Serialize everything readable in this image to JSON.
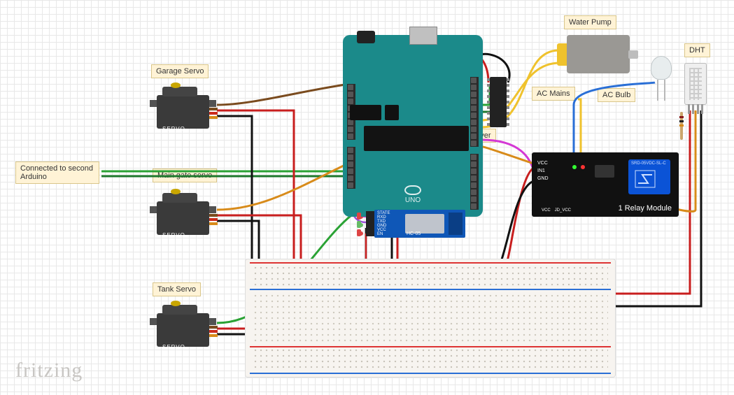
{
  "labels": {
    "garage_servo": "Garage Servo",
    "main_gate_servo": "Main gate servo",
    "tank_servo": "Tank Servo",
    "connected_second": "Connected to second\nArduino",
    "water_pump": "Water Pump",
    "dht": "DHT",
    "ac_mains": "AC Mains",
    "ac_bulb": "AC Bulb",
    "motor_driver": "Motor Driver"
  },
  "components": {
    "arduino": {
      "model": "UNO",
      "brand": "Arduino"
    },
    "relay": {
      "title": "1 Relay Module",
      "pins": [
        "VCC",
        "IN1",
        "GND"
      ],
      "bottom_pins": [
        "VCC",
        "JD_VCC"
      ],
      "part_no": "SRD-05VDC-SL-C"
    },
    "bluetooth": {
      "model": "HC-05",
      "pin_labels": [
        "STATE",
        "RXD",
        "TXD",
        "GND",
        "VCC",
        "EN"
      ]
    },
    "servos": [
      {
        "role": "garage",
        "text": "SERVO"
      },
      {
        "role": "main_gate",
        "text": "SERVO"
      },
      {
        "role": "tank",
        "text": "SERVO"
      }
    ],
    "dht_sensor": {
      "pins": 4
    },
    "led": {
      "type": "RGB clear"
    },
    "motor_driver_ic": {
      "pins": 16
    }
  },
  "wire_colors": {
    "5v": "#c81e1e",
    "gnd": "#111111",
    "brown": "#7a4b1e",
    "orange": "#d88b1a",
    "yellow": "#efc22d",
    "green": "#2aa234",
    "green2": "#1f7a2e",
    "blue": "#2a6fd6",
    "magenta": "#d438d4",
    "violet": "#9b4dd6",
    "grey": "#8a8a8a",
    "darkred": "#8a1c1c"
  },
  "watermark": "fritzing"
}
